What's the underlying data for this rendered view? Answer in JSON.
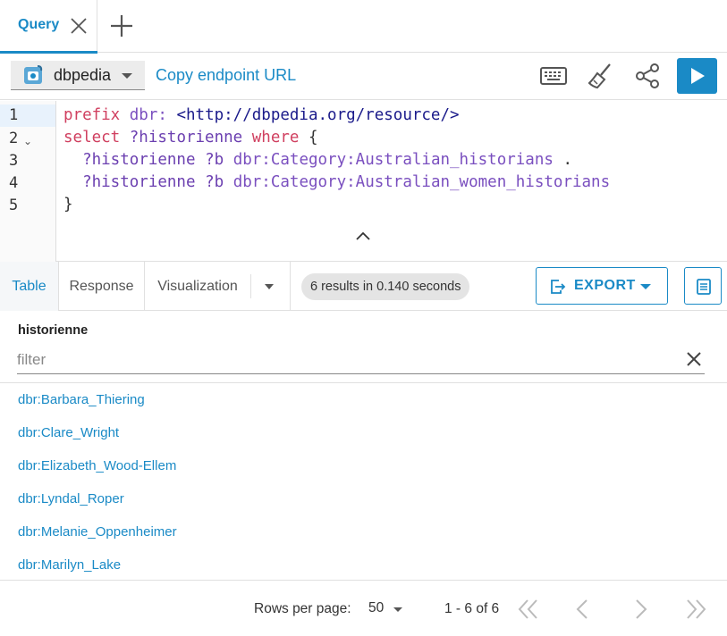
{
  "tabs": [
    {
      "label": "Query",
      "active": true
    }
  ],
  "controls": {
    "endpoint_label": "dbpedia",
    "copy_link": "Copy endpoint URL"
  },
  "editor": {
    "line_numbers": [
      "1",
      "2",
      "3",
      "4",
      "5"
    ],
    "lines": [
      [
        {
          "t": "prefix",
          "c": "kw"
        },
        {
          "t": " ",
          "c": "pun"
        },
        {
          "t": "dbr:",
          "c": "pfx"
        },
        {
          "t": " <http://dbpedia.org/resource/>",
          "c": "uri"
        }
      ],
      [
        {
          "t": "select",
          "c": "kw"
        },
        {
          "t": " ",
          "c": "pun"
        },
        {
          "t": "?historienne",
          "c": "var"
        },
        {
          "t": " ",
          "c": "pun"
        },
        {
          "t": "where",
          "c": "kw"
        },
        {
          "t": " {",
          "c": "pun"
        }
      ],
      [
        {
          "t": "  ",
          "c": "pun"
        },
        {
          "t": "?historienne",
          "c": "var"
        },
        {
          "t": " ",
          "c": "pun"
        },
        {
          "t": "?b",
          "c": "var"
        },
        {
          "t": " ",
          "c": "pun"
        },
        {
          "t": "dbr:Category:Australian_historians",
          "c": "pfx"
        },
        {
          "t": " .",
          "c": "pun"
        }
      ],
      [
        {
          "t": "  ",
          "c": "pun"
        },
        {
          "t": "?historienne",
          "c": "var"
        },
        {
          "t": " ",
          "c": "pun"
        },
        {
          "t": "?b",
          "c": "var"
        },
        {
          "t": " ",
          "c": "pun"
        },
        {
          "t": "dbr:Category:Australian_women_historians",
          "c": "pfx"
        }
      ],
      [
        {
          "t": "}",
          "c": "pun"
        }
      ]
    ]
  },
  "results": {
    "tabs": {
      "table": "Table",
      "response": "Response",
      "visualization": "Visualization"
    },
    "summary": "6 results in 0.140 seconds",
    "export_label": "EXPORT",
    "column_header": "historienne",
    "filter_placeholder": "filter",
    "rows": [
      "dbr:Barbara_Thiering",
      "dbr:Clare_Wright",
      "dbr:Elizabeth_Wood-Ellem",
      "dbr:Lyndal_Roper",
      "dbr:Melanie_Oppenheimer",
      "dbr:Marilyn_Lake"
    ]
  },
  "pagination": {
    "rows_per_page_label": "Rows per page:",
    "rows_per_page": "50",
    "range": "1 - 6 of 6"
  },
  "colors": {
    "accent": "#1a8ac6",
    "keyword": "#d04060",
    "prefix": "#7a4fbf"
  },
  "icons": [
    "close-icon",
    "plus-icon",
    "database-icon",
    "keyboard-icon",
    "broom-icon",
    "share-icon",
    "play-icon",
    "chevron-up-icon",
    "export-icon",
    "document-icon",
    "first-page-icon",
    "prev-page-icon",
    "next-page-icon",
    "last-page-icon"
  ]
}
